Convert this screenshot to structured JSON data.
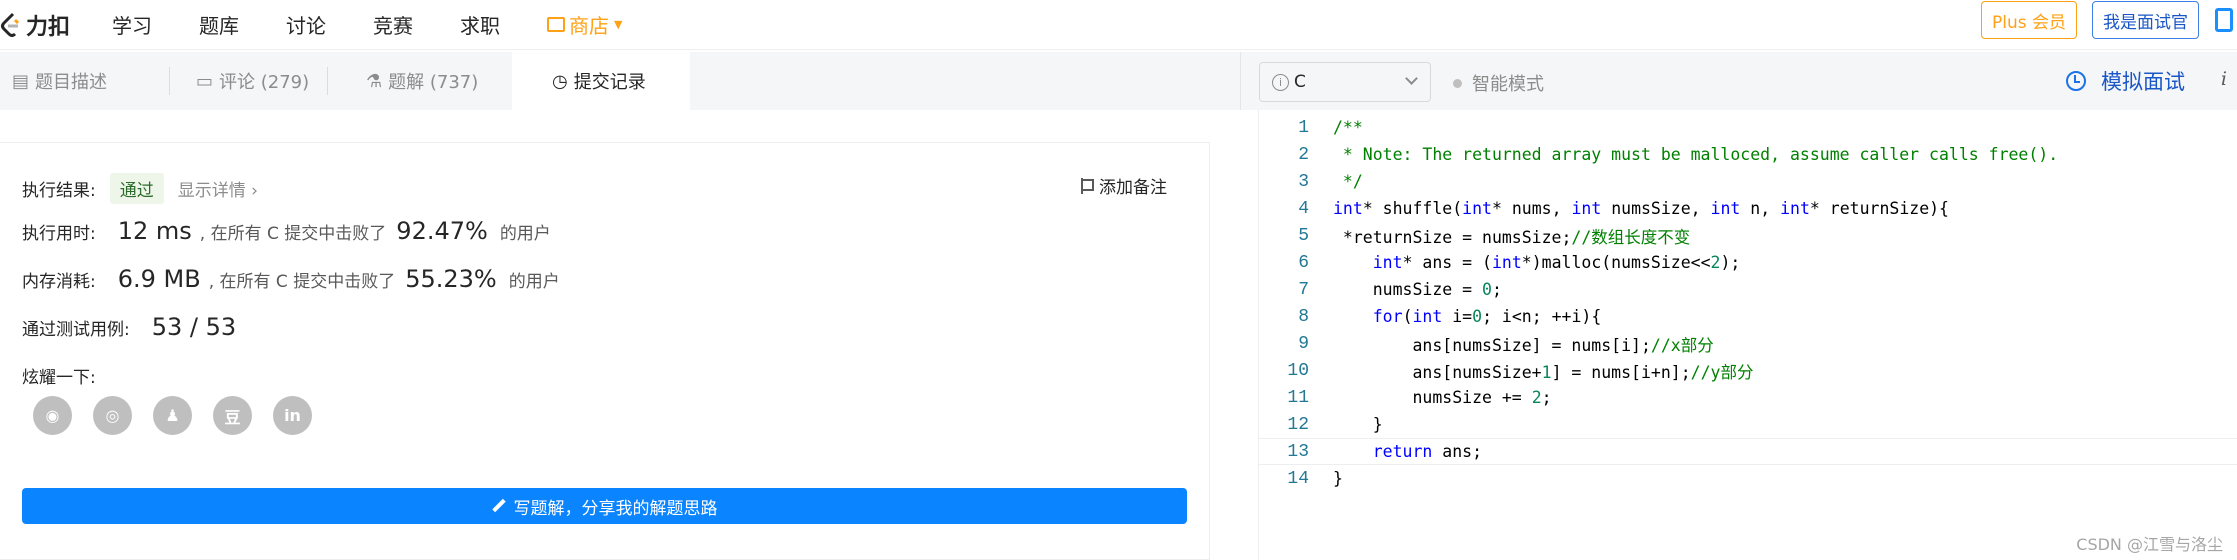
{
  "brand": {
    "name": "力扣"
  },
  "nav": {
    "links": [
      "学习",
      "题库",
      "讨论",
      "竞赛",
      "求职"
    ],
    "store": "商店",
    "plus": "Plus 会员",
    "interviewer": "我是面试官"
  },
  "left_tabs": [
    {
      "label": "题目描述"
    },
    {
      "label": "评论 (279)"
    },
    {
      "label": "题解 (737)"
    },
    {
      "label": "提交记录"
    }
  ],
  "result": {
    "label": "执行结果:",
    "status": "通过",
    "detail": "显示详情 ›",
    "add_note": "添加备注"
  },
  "runtime": {
    "label": "执行用时:",
    "value": "12 ms",
    "mid": ", 在所有 C 提交中击败了",
    "percent": "92.47%",
    "tail": "的用户"
  },
  "memory": {
    "label": "内存消耗:",
    "value": "6.9 MB",
    "mid": ", 在所有 C 提交中击败了",
    "percent": "55.23%",
    "tail": "的用户"
  },
  "tests": {
    "label": "通过测试用例:",
    "value": "53 / 53"
  },
  "share": {
    "label": "炫耀一下:",
    "icons": [
      "wechat-icon",
      "weibo-icon",
      "qq-icon",
      "douban-icon",
      "linkedin-icon"
    ]
  },
  "write_solution": "写题解，分享我的解题思路",
  "editor": {
    "language": "C",
    "smart_mode": "智能模式",
    "mock_interview": "模拟面试",
    "info": "i",
    "lines": [
      "1",
      "2",
      "3",
      "4",
      "5",
      "6",
      "7",
      "8",
      "9",
      "10",
      "11",
      "12",
      "13",
      "14"
    ]
  },
  "watermark": "CSDN @江雪与洛尘",
  "colors": {
    "accent": "#0a84ff",
    "store": "#ffa116",
    "comment": "#008000",
    "keyword": "#0000ff"
  }
}
